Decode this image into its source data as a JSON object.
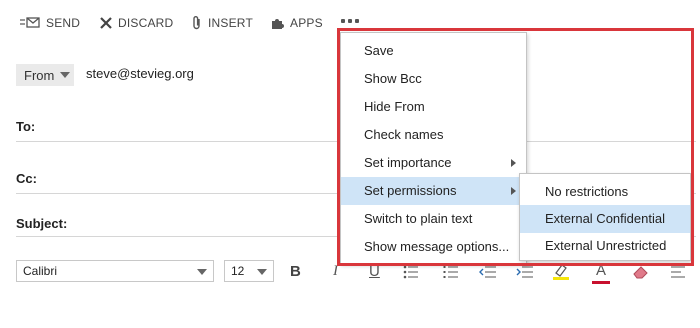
{
  "toolbar": {
    "send": "SEND",
    "discard": "DISCARD",
    "insert": "INSERT",
    "apps": "APPS"
  },
  "from": {
    "label": "From",
    "email": "steve@stevieg.org"
  },
  "fields": {
    "to": "To:",
    "cc": "Cc:",
    "subject": "Subject:"
  },
  "format": {
    "font": "Calibri",
    "size": "12",
    "bold": "B",
    "italic": "I",
    "underline": "U",
    "font_color": "A"
  },
  "menu": {
    "items": [
      "Save",
      "Show Bcc",
      "Hide From",
      "Check names",
      "Set importance",
      "Set permissions",
      "Switch to plain text",
      "Show message options..."
    ]
  },
  "submenu": {
    "items": [
      "No restrictions",
      "External Confidential",
      "External Unrestricted"
    ]
  },
  "colors": {
    "highlight_border": "#d9363b",
    "menu_hover": "#cfe4f7",
    "highlighter_yellow": "#f5e50a",
    "font_color_red": "#c8102e"
  }
}
